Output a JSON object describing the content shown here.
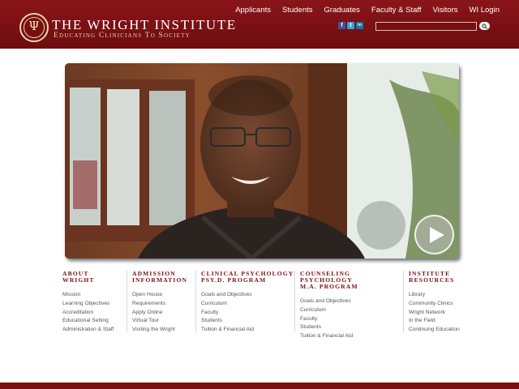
{
  "brand": {
    "seal_symbol": "Ψ",
    "seal_text": "WRIGHT INSTITUTE",
    "title": "The Wright Institute",
    "tagline": "Educating Clinicians To Society"
  },
  "topnav": [
    "Applicants",
    "Students",
    "Graduates",
    "Faculty & Staff",
    "Visitors",
    "WI Login"
  ],
  "social": [
    {
      "name": "facebook",
      "glyph": "f",
      "color": "#3b5998"
    },
    {
      "name": "twitter",
      "glyph": "t",
      "color": "#2fa8d8"
    },
    {
      "name": "linkedin",
      "glyph": "in",
      "color": "#0e76a8"
    }
  ],
  "search": {
    "value": "",
    "placeholder": "",
    "icon": "search-icon"
  },
  "hero": {
    "play_icon": "play-icon"
  },
  "columns": [
    {
      "title": "About\nWright",
      "items": [
        "Mission",
        "Learning Objectives",
        "Accreditation",
        "Educational Setting",
        "Administration & Staff"
      ]
    },
    {
      "title": "Admission\nInformation",
      "items": [
        "Open House",
        "Requirements",
        "Apply Online",
        "Virtual Tour",
        "Visiting the Wright"
      ]
    },
    {
      "title": "Clinical Psychology\nPsy.D. Program",
      "items": [
        "Goals and Objectives",
        "Curriculum",
        "Faculty",
        "Students",
        "Tuition & Financial Aid"
      ]
    },
    {
      "title": "Counseling Psychology\nM.A. Program",
      "items": [
        "Goals and Objectives",
        "Curriculum",
        "Faculty",
        "Students",
        "Tuition & Financial Aid"
      ]
    },
    {
      "title": "Institute\nResources",
      "items": [
        "Library",
        "Community Clinics",
        "Wright Network",
        "In the Field",
        "Continuing Education"
      ]
    }
  ],
  "colors": {
    "brand_red": "#7a0f12",
    "accent_gold": "#e9d7a8",
    "link_gray": "#555555"
  }
}
